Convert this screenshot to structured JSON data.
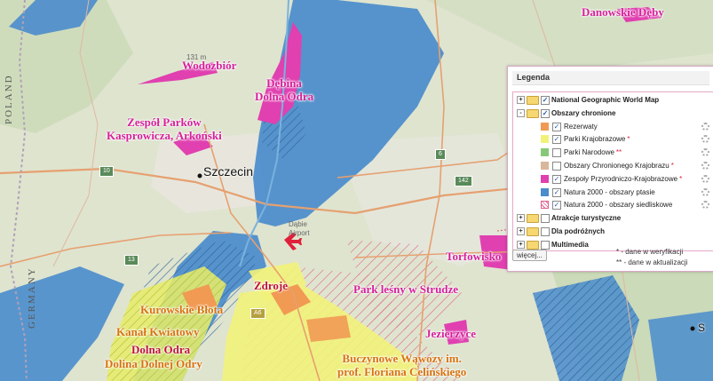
{
  "map": {
    "labels": {
      "danowskie_deby": "Danowskie Dęby",
      "wodozbior": "Wodozbiór",
      "debina_dolna_odra": [
        "Dębina",
        "Dolna Odra"
      ],
      "zespol_parkow": [
        "Zespół Parków",
        "Kasprowicza, Arkoński"
      ],
      "zdroje": "Zdroje",
      "park_lesny": "Park leśny w Strudze",
      "torfowisko": "Torfowisko",
      "kurowskie_blota": "Kurowskie Błota",
      "kanal_kwiatowy": "Kanał Kwiatowy",
      "dolna_odra": "Dolna Odra",
      "dolina_dolnej_odry": "Dolina Dolnej Odry",
      "jezierzyce": "Jezierzyce",
      "buczynowe": [
        "Buczynowe Wąwozy im.",
        "prof. Floriana Celińskiego"
      ]
    },
    "city": "Szczecin",
    "airport": [
      "Dąbie",
      "Airport"
    ],
    "elevation": "131 m",
    "countries": {
      "poland": "POLAND",
      "germany": "GERMANY"
    },
    "roads": [
      "10",
      "6",
      "142",
      "13",
      "A6"
    ],
    "edge_label": "S"
  },
  "legend": {
    "title": "Legenda",
    "items": [
      {
        "label": "National Geographic World Map",
        "bold": true,
        "group": true,
        "checked": true,
        "expander": "+"
      },
      {
        "label": "Obszary chronione",
        "bold": true,
        "group": true,
        "checked": true,
        "expander": "-"
      },
      {
        "label": "Rezerwaty",
        "swatch": "#f19a54",
        "checked": true,
        "star": ""
      },
      {
        "label": "Parki Krajobrazowe",
        "swatch": "#f2f27a",
        "checked": true,
        "star": "*"
      },
      {
        "label": "Parki Narodowe",
        "swatch": "#87c878",
        "checked": false,
        "star": "**"
      },
      {
        "label": "Obszary Chronionego Krajobrazu",
        "swatch": "#d9b79b",
        "checked": false,
        "star": "*"
      },
      {
        "label": "Zespoły Przyrodniczo-Krajobrazowe",
        "swatch": "#e040b0",
        "checked": true,
        "star": "*"
      },
      {
        "label": "Natura 2000 - obszary ptasie",
        "swatch": "#4a8ccc",
        "checked": true,
        "star": ""
      },
      {
        "label": "Natura 2000 - obszary siedliskowe",
        "swatch": "hatch",
        "checked": true,
        "star": ""
      },
      {
        "label": "Atrakcje turystyczne",
        "bold": true,
        "group": true,
        "checked": false,
        "expander": "+"
      },
      {
        "label": "Dla podróżnych",
        "bold": true,
        "group": true,
        "checked": false,
        "expander": "+"
      },
      {
        "label": "Multimedia",
        "bold": true,
        "group": true,
        "checked": false,
        "expander": "+"
      }
    ],
    "more_button": "więcej...",
    "notes": [
      "* - dane w weryfikacji",
      "** - dane w aktualizacji"
    ]
  },
  "colors": {
    "natura_ptasie": "#4a8ccc",
    "zespoly": "#e040b0",
    "parki_krajobrazowe": "#f2f27a",
    "rezerwaty": "#f19a54"
  }
}
